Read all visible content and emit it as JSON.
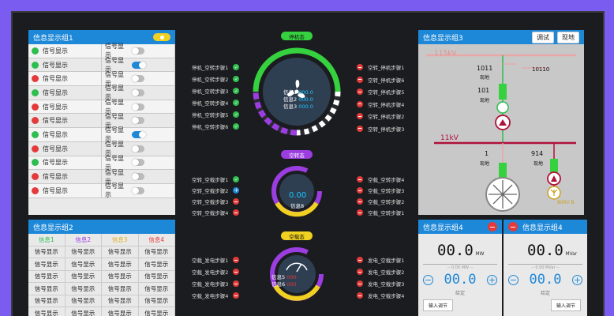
{
  "group1": {
    "title": "信息显示组1",
    "rows": [
      {
        "left": "信号显示",
        "lcolor": "#2ebd4f",
        "right": "信号显示",
        "on": false
      },
      {
        "left": "信号显示",
        "lcolor": "#2ebd4f",
        "right": "信号显示",
        "on": true
      },
      {
        "left": "信号显示",
        "lcolor": "#e43a3a",
        "right": "信号显示",
        "on": false
      },
      {
        "left": "信号显示",
        "lcolor": "#2ebd4f",
        "right": "信号显示",
        "on": false
      },
      {
        "left": "信号显示",
        "lcolor": "#e43a3a",
        "right": "信号显示",
        "on": false
      },
      {
        "left": "信号显示",
        "lcolor": "#e43a3a",
        "right": "信号显示",
        "on": false
      },
      {
        "left": "信号显示",
        "lcolor": "#2ebd4f",
        "right": "信号显示",
        "on": true
      },
      {
        "left": "信号显示",
        "lcolor": "#e43a3a",
        "right": "信号显示",
        "on": false
      },
      {
        "left": "信号显示",
        "lcolor": "#2ebd4f",
        "right": "信号显示",
        "on": false
      },
      {
        "left": "信号显示",
        "lcolor": "#e43a3a",
        "right": "信号显示",
        "on": false
      },
      {
        "left": "信号显示",
        "lcolor": "#e43a3a",
        "right": "信号显示",
        "on": false
      }
    ]
  },
  "group2": {
    "title": "信息显示组2",
    "headers": [
      {
        "label": "信息1",
        "color": "#2ebd4f"
      },
      {
        "label": "信息2",
        "color": "#9b3de0"
      },
      {
        "label": "信息3",
        "color": "#e0b020"
      },
      {
        "label": "信息4",
        "color": "#e43a3a"
      }
    ],
    "cell": "信号显示"
  },
  "center": {
    "state1": "停机态",
    "state2": "空转态",
    "state3": "空载态",
    "g1": {
      "l1": "信息1",
      "l2": "信息2",
      "l3": "信息3",
      "v1": "000.0",
      "v2": "000.0",
      "v3": "000.0"
    },
    "g2": {
      "val": "0.00",
      "label": "信息8"
    },
    "g3": {
      "l1": "信息5",
      "l2": "信息6",
      "v1": "000",
      "v2": "000"
    },
    "steps_a_left": [
      "停机_空转步骤1",
      "停机_空转步骤2",
      "停机_空转步骤3",
      "停机_空转步骤4",
      "停机_空转步骤5",
      "停机_空转步骤6"
    ],
    "steps_a_right": [
      "空转_停机步骤1",
      "空转_停机步骤6",
      "空转_停机步骤5",
      "空转_停机步骤4",
      "空转_停机步骤2",
      "空转_停机步骤3"
    ],
    "steps_b_left": [
      "空转_空载步骤1",
      "空转_空载步骤2",
      "空转_空载步骤3",
      "空转_空载步骤4"
    ],
    "steps_b_right": [
      "空载_空转步骤4",
      "空载_空转步骤3",
      "空载_空转步骤2",
      "空载_空转步骤1"
    ],
    "steps_c_left": [
      "空载_发电步骤1",
      "空载_发电步骤2",
      "空载_发电步骤3",
      "空载_发电步骤4"
    ],
    "steps_c_right": [
      "发电_空载步骤1",
      "发电_空载步骤2",
      "发电_空载步骤3",
      "发电_空载步骤4"
    ]
  },
  "group3": {
    "title": "信息显示组3",
    "btn1": "调试",
    "btn2": "现地",
    "v115": "115kV",
    "v11": "11kV",
    "n1011": "1011",
    "n10110": "10110",
    "n101": "101",
    "n1": "1",
    "n914": "914",
    "local": "现地",
    "volt": "800V B"
  },
  "group4": {
    "title": "信息显示组4",
    "big": "00.0",
    "unit": "MW",
    "sub": "00.0",
    "subu": "MW",
    "note": "给定",
    "btn": "输入调节"
  },
  "group5": {
    "title": "信息显示组4",
    "big": "00.0",
    "unit": "MVar",
    "sub": "00.0",
    "subu": "MVar",
    "note": "给定",
    "btn": "输入调节"
  }
}
